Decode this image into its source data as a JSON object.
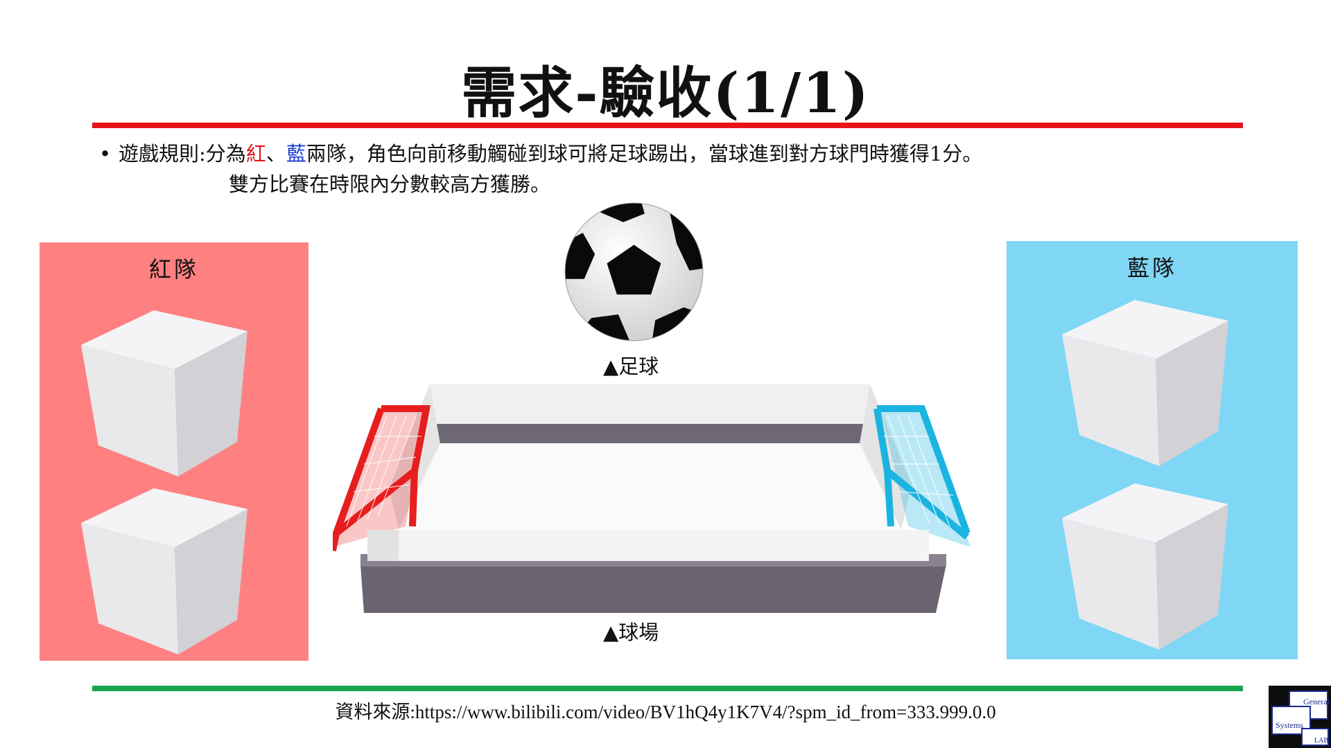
{
  "slide": {
    "title": "需求-驗收(1/1)",
    "bullet": {
      "marker": "•",
      "prefix": "遊戲規則:分為",
      "red_word": "紅",
      "sep": "、",
      "blue_word": "藍",
      "rest_line1": "兩隊，角色向前移動觸碰到球可將足球踢出，當球進到對方球門時獲得1分。",
      "line2": "雙方比賽在時限內分數較高方獲勝。"
    },
    "red_team_label": "紅隊",
    "blue_team_label": "藍隊",
    "ball_caption": "▲足球",
    "field_caption": "▲球場",
    "source": "資料來源:https://www.bilibili.com/video/BV1hQ4y1K7V4/?spm_id_from=333.999.0.0",
    "logo": {
      "word1": "General",
      "word2": "Systems",
      "word3": "LAB"
    }
  },
  "colors": {
    "title_rule": "#e8141a",
    "footer_rule": "#19a351",
    "red_panel": "#ff8080",
    "blue_panel": "#80d6f5",
    "red_goal": "#e61e1e",
    "blue_goal": "#1bb4e0"
  },
  "icons": [
    "soccer-ball-icon",
    "cube-icon",
    "field-illustration",
    "logo-icon"
  ]
}
